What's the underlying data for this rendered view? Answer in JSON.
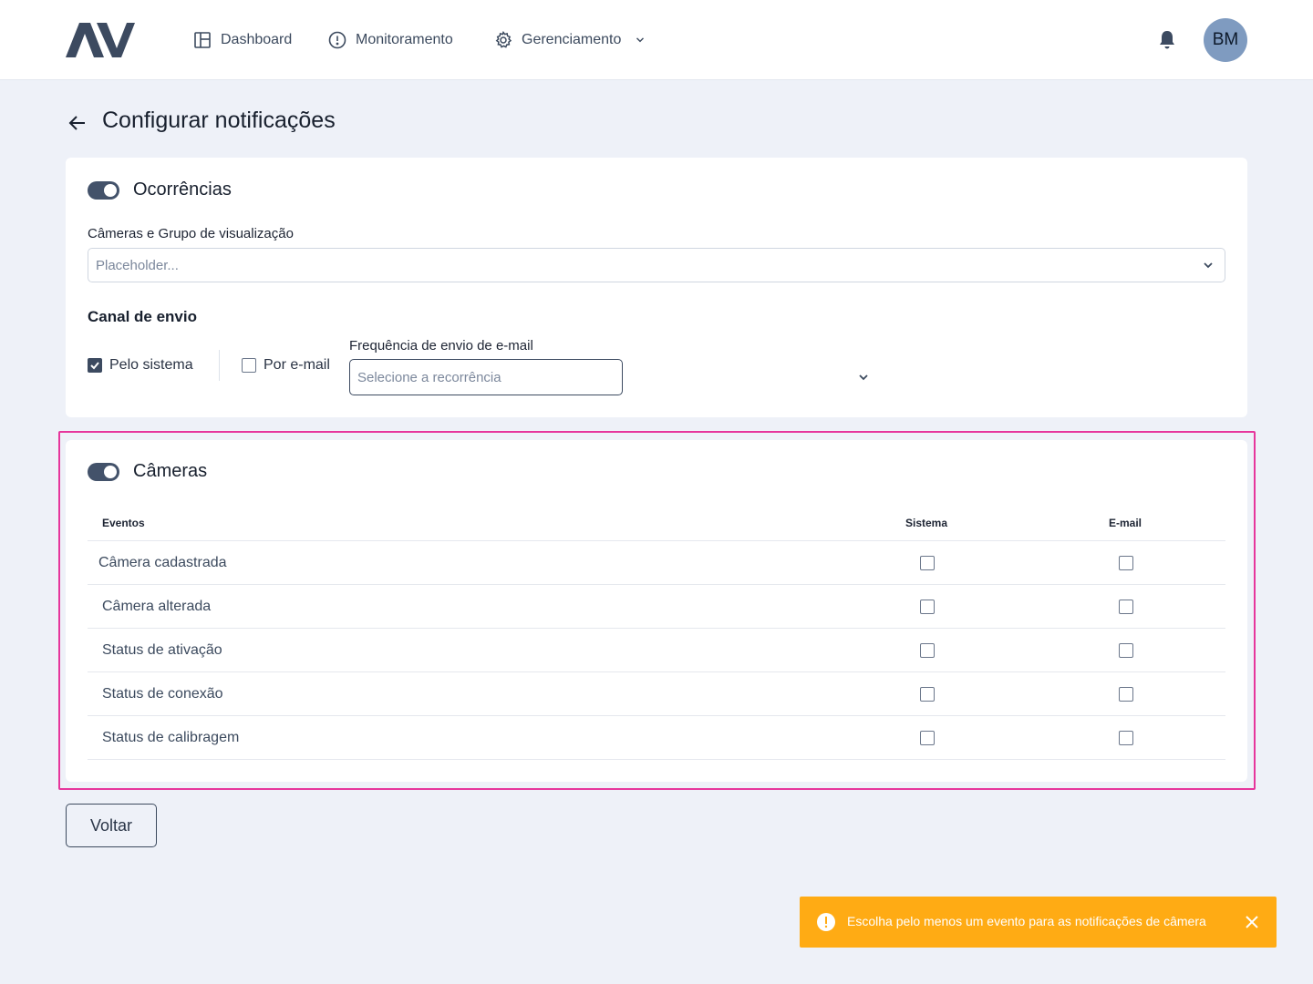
{
  "nav": {
    "logo_text": "AV",
    "items": [
      {
        "label": "Dashboard",
        "icon": "layout-icon"
      },
      {
        "label": "Monitoramento",
        "icon": "alert-circle-icon"
      },
      {
        "label": "Gerenciamento",
        "icon": "gear-icon"
      }
    ],
    "avatar_initials": "BM"
  },
  "page": {
    "title": "Configurar notificações"
  },
  "occurrences": {
    "title": "Ocorrências",
    "enabled": true,
    "cameras_label": "Câmeras e Grupo de visualização",
    "cameras_placeholder": "Placeholder...",
    "channel_title": "Canal de envio",
    "system_label": "Pelo sistema",
    "system_checked": true,
    "email_label": "Por e-mail",
    "email_checked": false,
    "frequency_label": "Frequência de envio de e-mail",
    "frequency_placeholder": "Selecione a recorrência"
  },
  "cameras": {
    "title": "Câmeras",
    "enabled": true,
    "columns": {
      "events": "Eventos",
      "system": "Sistema",
      "email": "E-mail"
    },
    "rows": [
      {
        "label": "Câmera cadastrada",
        "system": false,
        "email": false
      },
      {
        "label": "Câmera alterada",
        "system": false,
        "email": false
      },
      {
        "label": "Status de ativação",
        "system": false,
        "email": false
      },
      {
        "label": "Status de conexão",
        "system": false,
        "email": false
      },
      {
        "label": "Status de calibragem",
        "system": false,
        "email": false
      }
    ]
  },
  "actions": {
    "back_label": "Voltar"
  },
  "toast": {
    "message": "Escolha pelo menos um evento para as notificações de câmera",
    "color": "#ffab14"
  }
}
